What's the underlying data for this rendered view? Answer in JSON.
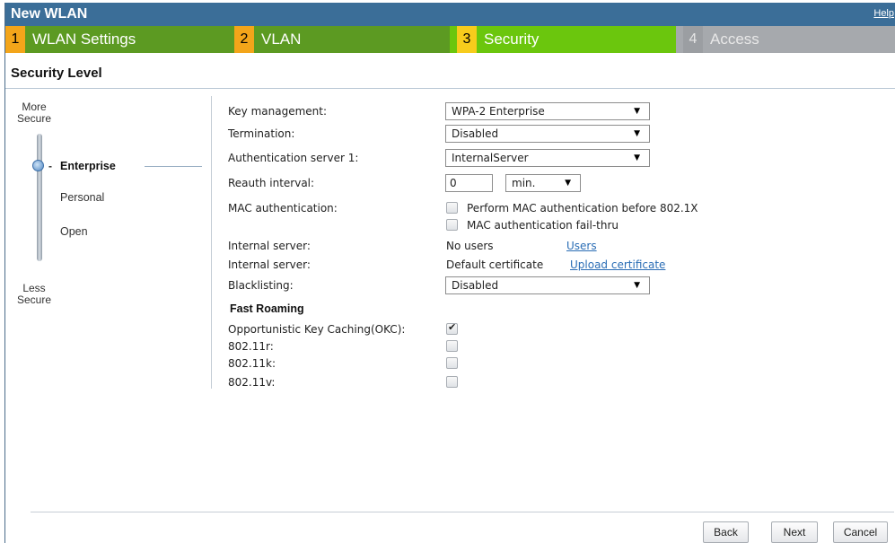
{
  "window": {
    "title": "New WLAN",
    "help_label": "Help"
  },
  "steps": [
    {
      "num": "1",
      "label": "WLAN Settings"
    },
    {
      "num": "2",
      "label": "VLAN"
    },
    {
      "num": "3",
      "label": "Security"
    },
    {
      "num": "4",
      "label": "Access"
    }
  ],
  "section": {
    "title": "Security Level"
  },
  "slider": {
    "more_secure": [
      "More",
      "Secure"
    ],
    "less_secure": [
      "Less",
      "Secure"
    ],
    "levels": [
      "Enterprise",
      "Personal",
      "Open"
    ],
    "selected": "Enterprise"
  },
  "form": {
    "key_management": {
      "label": "Key management:",
      "value": "WPA-2 Enterprise"
    },
    "termination": {
      "label": "Termination:",
      "value": "Disabled"
    },
    "auth_server": {
      "label": "Authentication server 1:",
      "value": "InternalServer"
    },
    "reauth": {
      "label": "Reauth interval:",
      "value": "0",
      "unit": "min."
    },
    "mac_auth": {
      "label": "MAC authentication:",
      "option1": "Perform MAC authentication before 802.1X",
      "option2": "MAC authentication fail-thru"
    },
    "internal_server_users": {
      "label": "Internal server:",
      "value": "No users",
      "link": "Users"
    },
    "internal_server_cert": {
      "label": "Internal server:",
      "value": "Default certificate",
      "link": "Upload certificate"
    },
    "blacklisting": {
      "label": "Blacklisting:",
      "value": "Disabled"
    }
  },
  "fast_roaming": {
    "title": "Fast Roaming",
    "okc": {
      "label": "Opportunistic Key Caching(OKC):",
      "checked": true
    },
    "r": {
      "label": "802.11r:",
      "checked": false
    },
    "k": {
      "label": "802.11k:",
      "checked": false
    },
    "v": {
      "label": "802.11v:",
      "checked": false
    }
  },
  "buttons": {
    "back": "Back",
    "next": "Next",
    "cancel": "Cancel"
  },
  "colors": {
    "titlebar": "#3b6e98",
    "step_done": "#5c9a22",
    "step_active": "#6bc60d",
    "step_pending": "#a6a9ad",
    "link": "#2a6db5"
  }
}
